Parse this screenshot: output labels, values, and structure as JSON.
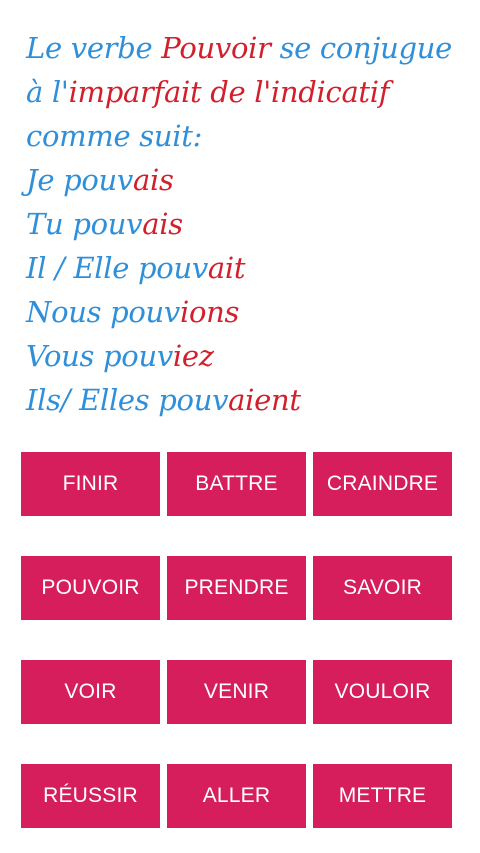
{
  "intro": {
    "line1": {
      "a": "Le verbe ",
      "b": "Pouvoir",
      "c": " se conjugue"
    },
    "line2": {
      "a": "à l'",
      "b": "imparfait de l'indicatif"
    },
    "line3": {
      "a": "comme suit:"
    }
  },
  "conjugations": [
    {
      "stem": "Je pouv",
      "ending": "ais"
    },
    {
      "stem": "Tu pouv",
      "ending": "ais"
    },
    {
      "stem": "Il / Elle pouv",
      "ending": "ait"
    },
    {
      "stem": "Nous pouv",
      "ending": "ions"
    },
    {
      "stem": "Vous pouv",
      "ending": "iez"
    },
    {
      "stem": "Ils/ Elles pouv",
      "ending": "aient"
    }
  ],
  "buttons": [
    [
      "FINIR",
      "BATTRE",
      "CRAINDRE"
    ],
    [
      "POUVOIR",
      "PRENDRE",
      "SAVOIR"
    ],
    [
      "VOIR",
      "VENIR",
      "VOULOIR"
    ],
    [
      "RÉUSSIR",
      "ALLER",
      "METTRE"
    ]
  ],
  "colors": {
    "blue_text": "#2f8fd8",
    "red_text": "#d21f2c",
    "button_bg": "#d61e5c",
    "button_text": "#ffffff"
  }
}
